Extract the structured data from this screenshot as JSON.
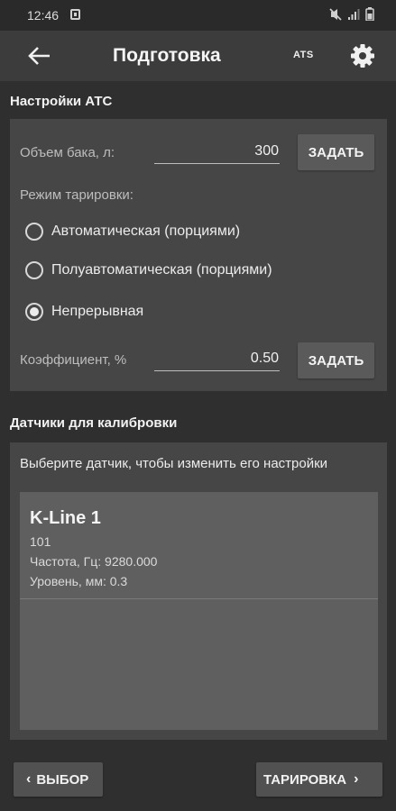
{
  "status_bar": {
    "time": "12:46",
    "notification_icon": "notification-square-icon",
    "icons": [
      "mute-icon",
      "signal-icon",
      "battery-icon"
    ]
  },
  "app_bar": {
    "title": "Подготовка",
    "ats_label": "ATS",
    "back_icon": "arrow-left-icon",
    "settings_icon": "gear-icon"
  },
  "ats_settings": {
    "section_title": "Настройки АТС",
    "tank_volume": {
      "label": "Объем бака, л:",
      "value": "300",
      "button": "ЗАДАТЬ"
    },
    "calibration_mode": {
      "label": "Режим тарировки:",
      "options": [
        {
          "label": "Автоматическая (порциями)",
          "checked": false
        },
        {
          "label": "Полуавтоматическая (порциями)",
          "checked": false
        },
        {
          "label": "Непрерывная",
          "checked": true
        }
      ]
    },
    "coefficient": {
      "label": "Коэффициент, %",
      "value": "0.50",
      "button": "ЗАДАТЬ"
    }
  },
  "sensors": {
    "section_title": "Датчики для калибровки",
    "hint": "Выберите датчик, чтобы изменить его настройки",
    "items": [
      {
        "name": "K-Line 1",
        "id": "101",
        "frequency": "Частота, Гц: 9280.000",
        "level": "Уровень, мм: 0.3"
      }
    ]
  },
  "bottom_nav": {
    "back_label": "ВЫБОР",
    "next_label": "ТАРИРОВКА",
    "back_chevron": "‹",
    "next_chevron": "›"
  },
  "colors": {
    "background": "#2f2f2f",
    "app_bar": "#3c3c3c",
    "card": "#464646",
    "sensor_list": "#5f5f5f",
    "button": "#5a5a5a"
  }
}
